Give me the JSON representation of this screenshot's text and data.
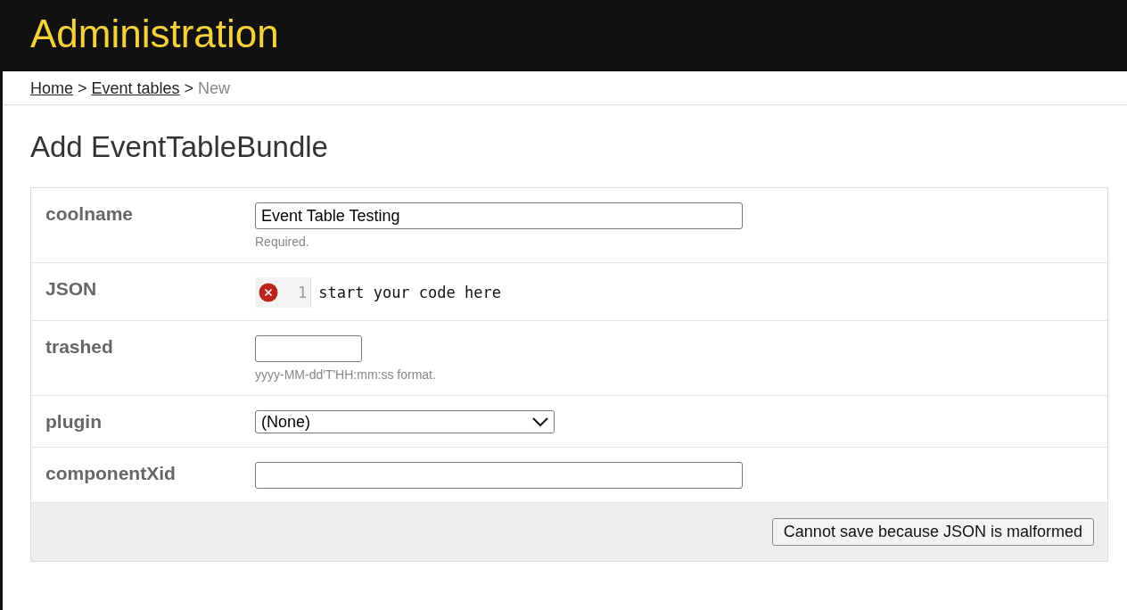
{
  "header": {
    "title": "Administration"
  },
  "breadcrumb": [
    {
      "label": "Home",
      "kind": "link"
    },
    {
      "label": "Event tables",
      "kind": "link"
    },
    {
      "label": "New",
      "kind": "current"
    }
  ],
  "breadcrumb_separator": ">",
  "heading": "Add EventTableBundle",
  "fields": [
    {
      "label": "coolname",
      "kind": "text",
      "value": "Event Table Testing",
      "help": "Required."
    },
    {
      "label": "JSON",
      "kind": "code",
      "line_number": "1",
      "value": "start your code here",
      "error": true
    },
    {
      "label": "trashed",
      "kind": "date",
      "help": "yyyy-MM-dd'T'HH:mm:ss format."
    },
    {
      "label": "plugin",
      "kind": "select",
      "value": "(None)"
    },
    {
      "label": "componentXid",
      "kind": "text"
    }
  ],
  "submit_button": "Cannot save because JSON is malformed"
}
